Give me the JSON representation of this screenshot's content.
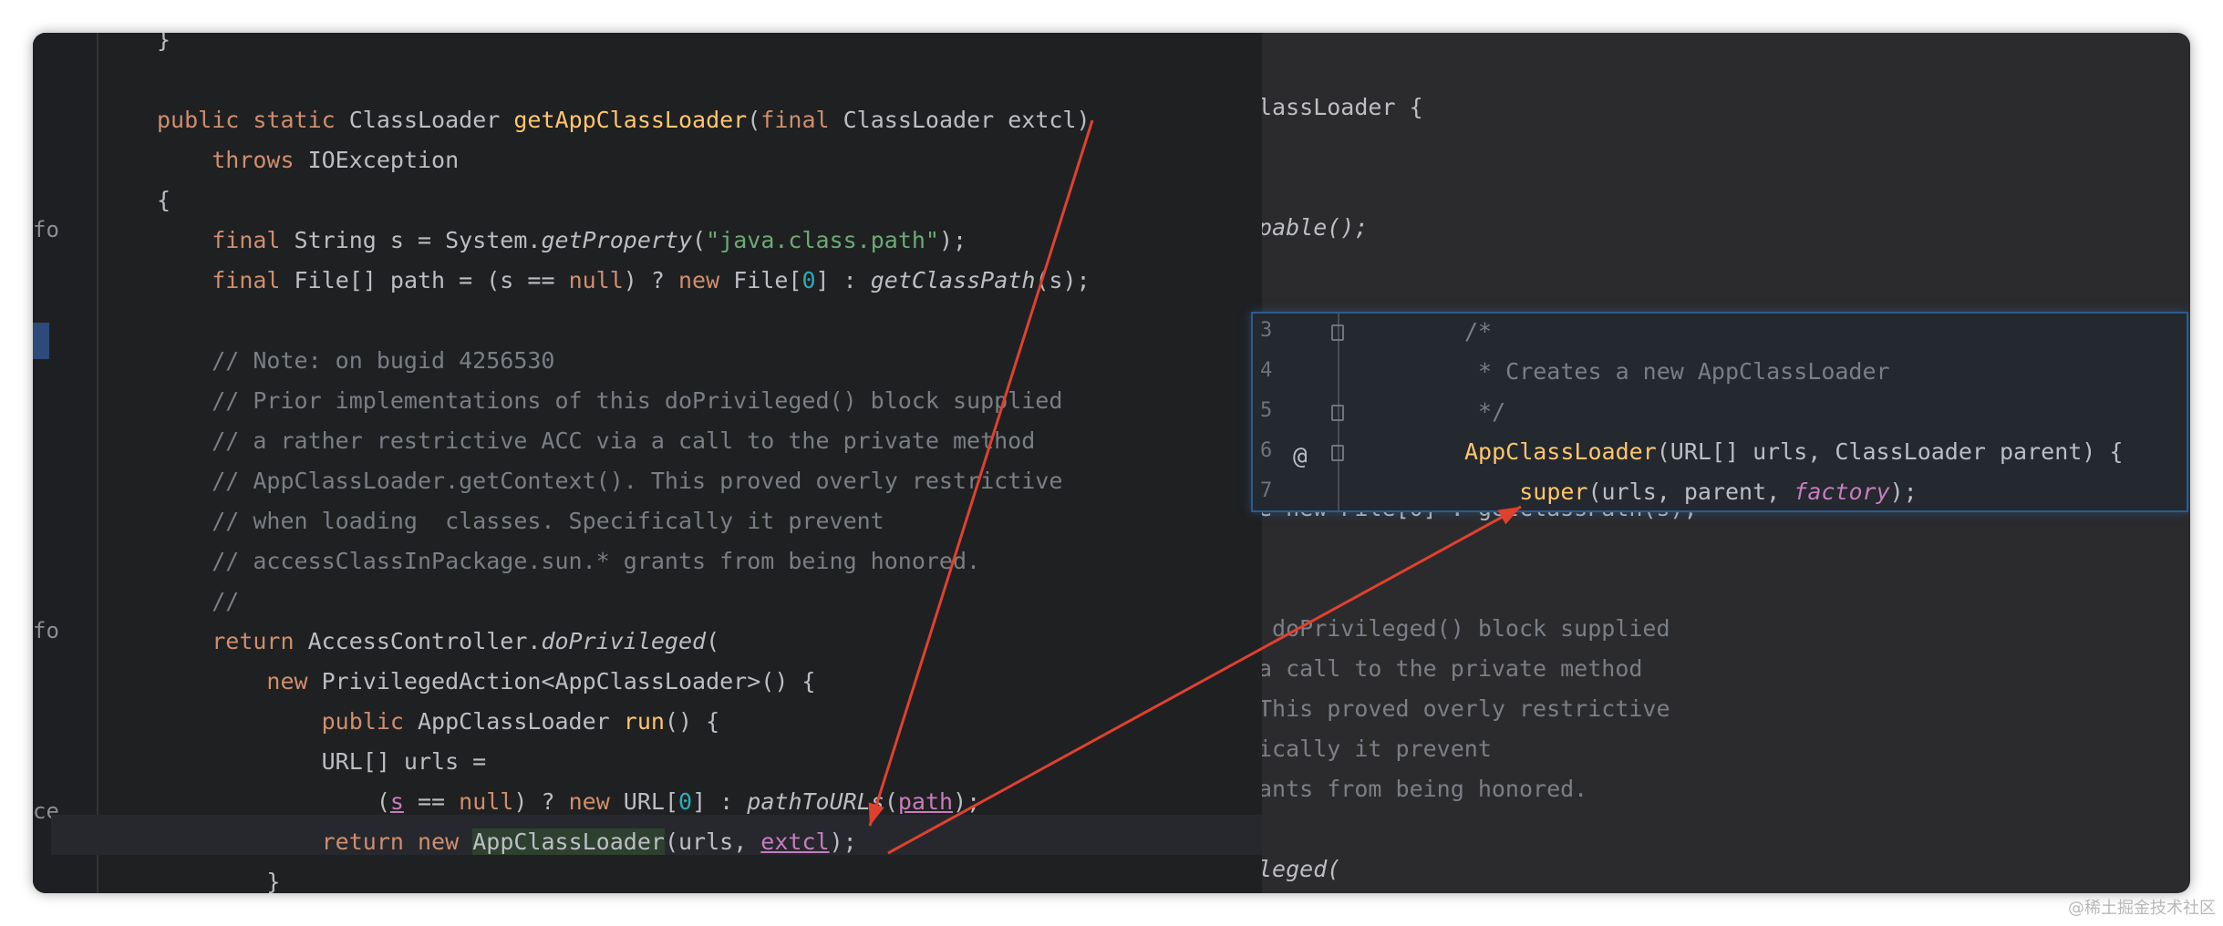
{
  "editor": {
    "lines": [
      "}",
      "",
      "public static ClassLoader getAppClassLoader(final ClassLoader extcl)",
      "    throws IOException",
      "{",
      "    final String s = System.getProperty(\"java.class.path\");",
      "    final File[] path = (s == null) ? new File[0] : getClassPath(s);",
      "",
      "    // Note: on bugid 4256530",
      "    // Prior implementations of this doPrivileged() block supplied",
      "    // a rather restrictive ACC via a call to the private method",
      "    // AppClassLoader.getContext(). This proved overly restrictive",
      "    // when loading  classes. Specifically it prevent",
      "    // accessClassInPackage.sun.* grants from being honored.",
      "    //",
      "    return AccessController.doPrivileged(",
      "        new PrivilegedAction<AppClassLoader>() {",
      "            public AppClassLoader run() {",
      "            URL[] urls =",
      "                (s == null) ? new URL[0] : pathToURLs(path);",
      "            return new AppClassLoader(urls, extcl);",
      "        }"
    ],
    "gutter_fragments": [
      "fo",
      "fo",
      "ce"
    ]
  },
  "background_code": {
    "lines": [
      "lassLoader {",
      "pable();",
      "e new File[0] : getClassPath(s);",
      " doPrivileged() block supplied",
      "a call to the private method",
      "This proved overly restrictive",
      "ically it prevent",
      "ants from being honored.",
      "leged("
    ]
  },
  "popup": {
    "line_numbers": [
      "3",
      "4",
      "5",
      "6",
      "7"
    ],
    "lines": [
      "/*",
      " * Creates a new AppClassLoader",
      " */",
      "AppClassLoader(URL[] urls, ClassLoader parent) {",
      "    super(urls, parent, factory);"
    ],
    "at_icon": "@"
  },
  "annotations": {
    "arrow_color": "#e0412f"
  },
  "watermark": "@稀土掘金技术社区"
}
